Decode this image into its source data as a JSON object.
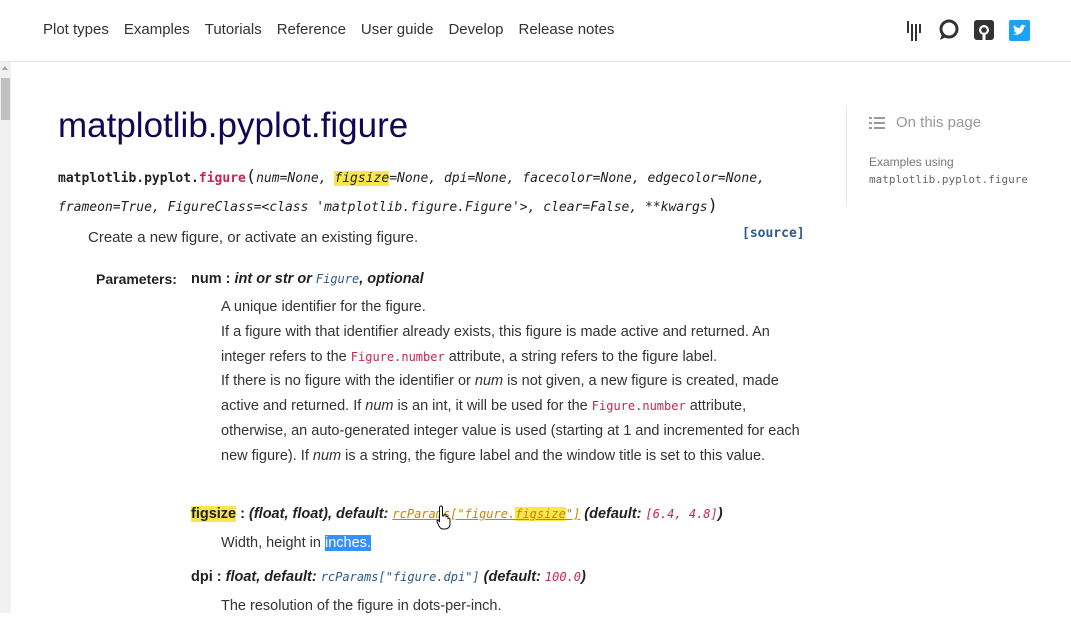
{
  "nav": {
    "items": [
      "Plot types",
      "Examples",
      "Tutorials",
      "Reference",
      "User guide",
      "Develop",
      "Release notes"
    ]
  },
  "header_icons": [
    "gitter-icon",
    "discourse-icon",
    "github-icon",
    "twitter-icon"
  ],
  "page": {
    "title": "matplotlib.pyplot.figure",
    "sig": {
      "module": "matplotlib.pyplot.",
      "name": "figure",
      "open": "(",
      "num": "num=None, ",
      "figsize_hl": "figsize",
      "rest1": "=None, dpi=None, facecolor=None, edgecolor=None,",
      "line2": "frameon=True, FigureClass=<class 'matplotlib.figure.Figure'>, clear=False, **kwargs",
      "close": ")"
    },
    "description": "Create a new figure, or activate an existing figure.",
    "source": "[source]",
    "parameters_label": "Parameters:"
  },
  "params": {
    "num": {
      "name": "num",
      "sep": " : ",
      "type1": "int or str or ",
      "type_code": "Figure",
      "type2": ", optional",
      "d1": "A unique identifier for the figure.",
      "d2a": "If a figure with that identifier already exists, this figure is made active and returned. An integer refers to the ",
      "d2code": "Figure.number",
      "d2b": " attribute, a string refers to the figure label.",
      "d3a": "If there is no figure with the identifier or ",
      "d3em1": "num",
      "d3b": " is not given, a new figure is created, made active and returned. If ",
      "d3em2": "num",
      "d3c": " is an int, it will be used for the ",
      "d3code": "Figure.number",
      "d3d": " attribute, otherwise, an auto-generated integer value is used (starting at 1 and incremented for each new figure). If ",
      "d3em3": "num",
      "d3e": " is a string, the figure label and the window title is set to this value."
    },
    "figsize": {
      "name": "figsize",
      "sep": " : ",
      "type": "(float, float), default: ",
      "code_a": "rcParams[\"figure.",
      "code_hl": "figsize",
      "code_b": "\"]",
      "def_label": " (default: ",
      "def_val": "[6.4, 4.8]",
      "def_close": ")",
      "desc_a": "Width, height in ",
      "desc_sel": "inches."
    },
    "dpi": {
      "name": "dpi",
      "sep": " : ",
      "type": "float, default: ",
      "code": "rcParams[\"figure.dpi\"]",
      "def_label": " (default: ",
      "def_val": "100.0",
      "def_close": ")",
      "desc": "The resolution of the figure in dots-per-inch."
    }
  },
  "sidebar": {
    "heading": "On this page",
    "item_label": "Examples using",
    "item_code": "matplotlib.pyplot.figure"
  }
}
